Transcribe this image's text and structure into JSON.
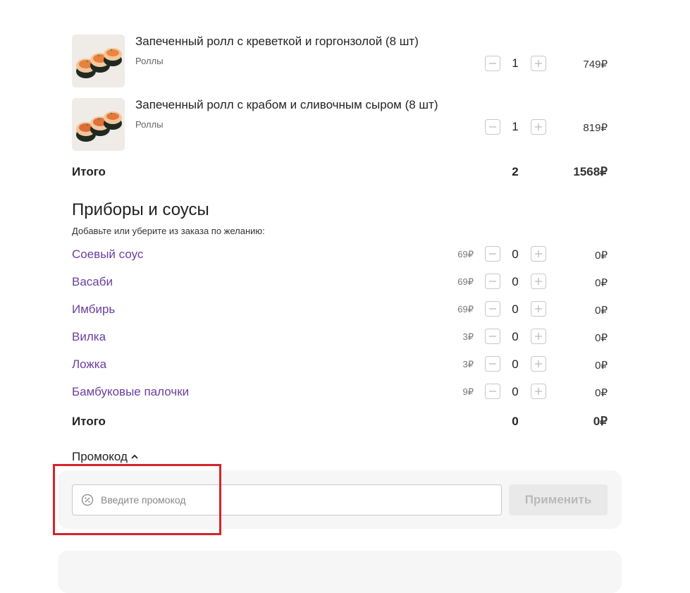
{
  "products": [
    {
      "name": "Запеченный ролл с креветкой и горгонзолой (8 шт)",
      "category": "Роллы",
      "qty": "1",
      "price": "749₽"
    },
    {
      "name": "Запеченный ролл с крабом и сливочным сыром (8 шт)",
      "category": "Роллы",
      "qty": "1",
      "price": "819₽"
    }
  ],
  "products_total": {
    "label": "Итого",
    "qty": "2",
    "price": "1568₽"
  },
  "extras": {
    "title": "Приборы и соусы",
    "subtitle": "Добавьте или уберите из заказа по желанию:",
    "items": [
      {
        "name": "Соевый соус",
        "unit_price": "69₽",
        "qty": "0",
        "price": "0₽"
      },
      {
        "name": "Васаби",
        "unit_price": "69₽",
        "qty": "0",
        "price": "0₽"
      },
      {
        "name": "Имбирь",
        "unit_price": "69₽",
        "qty": "0",
        "price": "0₽"
      },
      {
        "name": "Вилка",
        "unit_price": "3₽",
        "qty": "0",
        "price": "0₽"
      },
      {
        "name": "Ложка",
        "unit_price": "3₽",
        "qty": "0",
        "price": "0₽"
      },
      {
        "name": "Бамбуковые палочки",
        "unit_price": "9₽",
        "qty": "0",
        "price": "0₽"
      }
    ],
    "total": {
      "label": "Итого",
      "qty": "0",
      "price": "0₽"
    }
  },
  "promo": {
    "toggle_label": "Промокод",
    "placeholder": "Введите промокод",
    "value": "",
    "apply_label": "Применить"
  },
  "colors": {
    "accent_link": "#6b3fa0",
    "highlight": "#d8232a"
  },
  "icons": {
    "minus": "minus-icon",
    "plus": "plus-icon",
    "percent": "percent-icon",
    "chevron": "chevron-up-icon"
  }
}
